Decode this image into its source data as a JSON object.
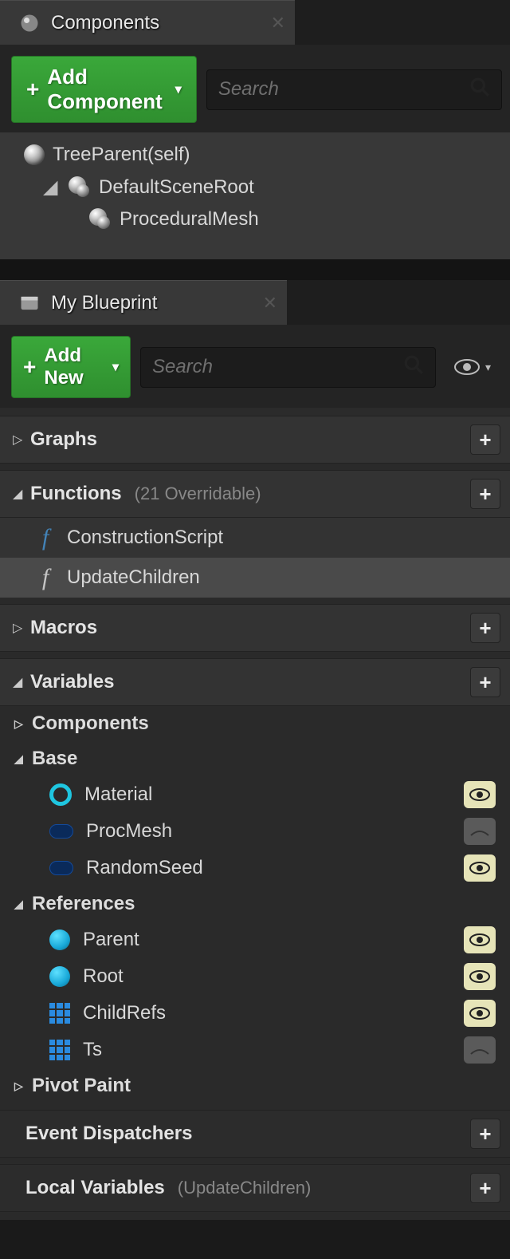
{
  "components_panel": {
    "tab_title": "Components",
    "add_button": "Add Component",
    "search_placeholder": "Search",
    "tree": {
      "root": "TreeParent(self)",
      "scene_root": "DefaultSceneRoot",
      "proc_mesh": "ProceduralMesh"
    }
  },
  "blueprint_panel": {
    "tab_title": "My Blueprint",
    "add_button": "Add New",
    "search_placeholder": "Search",
    "sections": {
      "graphs": "Graphs",
      "functions": "Functions",
      "functions_sub": "(21 Overridable)",
      "macros": "Macros",
      "variables": "Variables",
      "event_dispatchers": "Event Dispatchers",
      "local_variables": "Local Variables",
      "local_variables_sub": "(UpdateChildren)"
    },
    "functions": {
      "construction": "ConstructionScript",
      "update_children": "UpdateChildren"
    },
    "var_categories": {
      "components": "Components",
      "base": "Base",
      "references": "References",
      "pivot_paint": "Pivot Paint"
    },
    "vars": {
      "material": "Material",
      "procmesh": "ProcMesh",
      "randomseed": "RandomSeed",
      "parent": "Parent",
      "root": "Root",
      "childrefs": "ChildRefs",
      "ts": "Ts"
    }
  }
}
